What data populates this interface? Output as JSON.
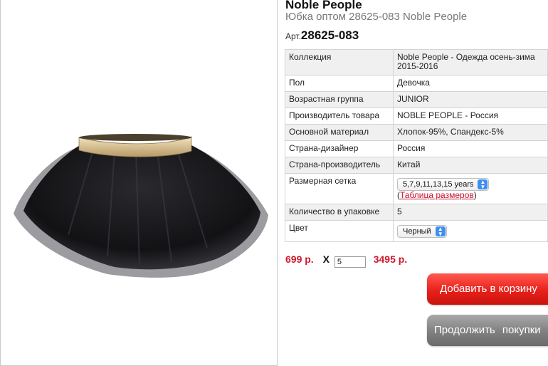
{
  "header": {
    "brand": "Noble People",
    "subtitle": "Юбка оптом 28625-083 Noble People",
    "article_prefix": "Арт.",
    "article_number": "28625-083"
  },
  "product_image": {
    "icon": "black-tulle-skirt-photo"
  },
  "specs": {
    "rows": [
      {
        "key": "Коллекция",
        "value": "Noble People - Одежда осень-зима 2015-2016"
      },
      {
        "key": "Пол",
        "value": "Девочка"
      },
      {
        "key": "Возрастная группа",
        "value": "JUNIOR"
      },
      {
        "key": "Производитель товара",
        "value": "NOBLE PEOPLE - Россия"
      },
      {
        "key": "Основной материал",
        "value": "Хлопок-95%, Спандекс-5%"
      },
      {
        "key": "Страна-дизайнер",
        "value": "Россия"
      },
      {
        "key": "Страна-производитель",
        "value": "Китай"
      }
    ],
    "size_grid": {
      "key": "Размерная сетка",
      "selected": "5,7,9,11,13,15 years",
      "link_open": "(",
      "link_label": "Таблица размеров",
      "link_close": ")"
    },
    "pack": {
      "key": "Количество в упаковке",
      "value": "5"
    },
    "color": {
      "key": "Цвет",
      "selected": "Черный"
    }
  },
  "pricing": {
    "unit_price": "699 р.",
    "times": "X",
    "quantity": "5",
    "total": "3495 р."
  },
  "buttons": {
    "add_to_cart": "Добавить в корзину",
    "continue_shopping": "Продолжить покупки"
  },
  "colors": {
    "price_red": "#d0182b",
    "cart_button": "#e8201a",
    "continue_button": "#808080",
    "link_red": "#c8102e",
    "select_accent": "#3d8ef0"
  }
}
